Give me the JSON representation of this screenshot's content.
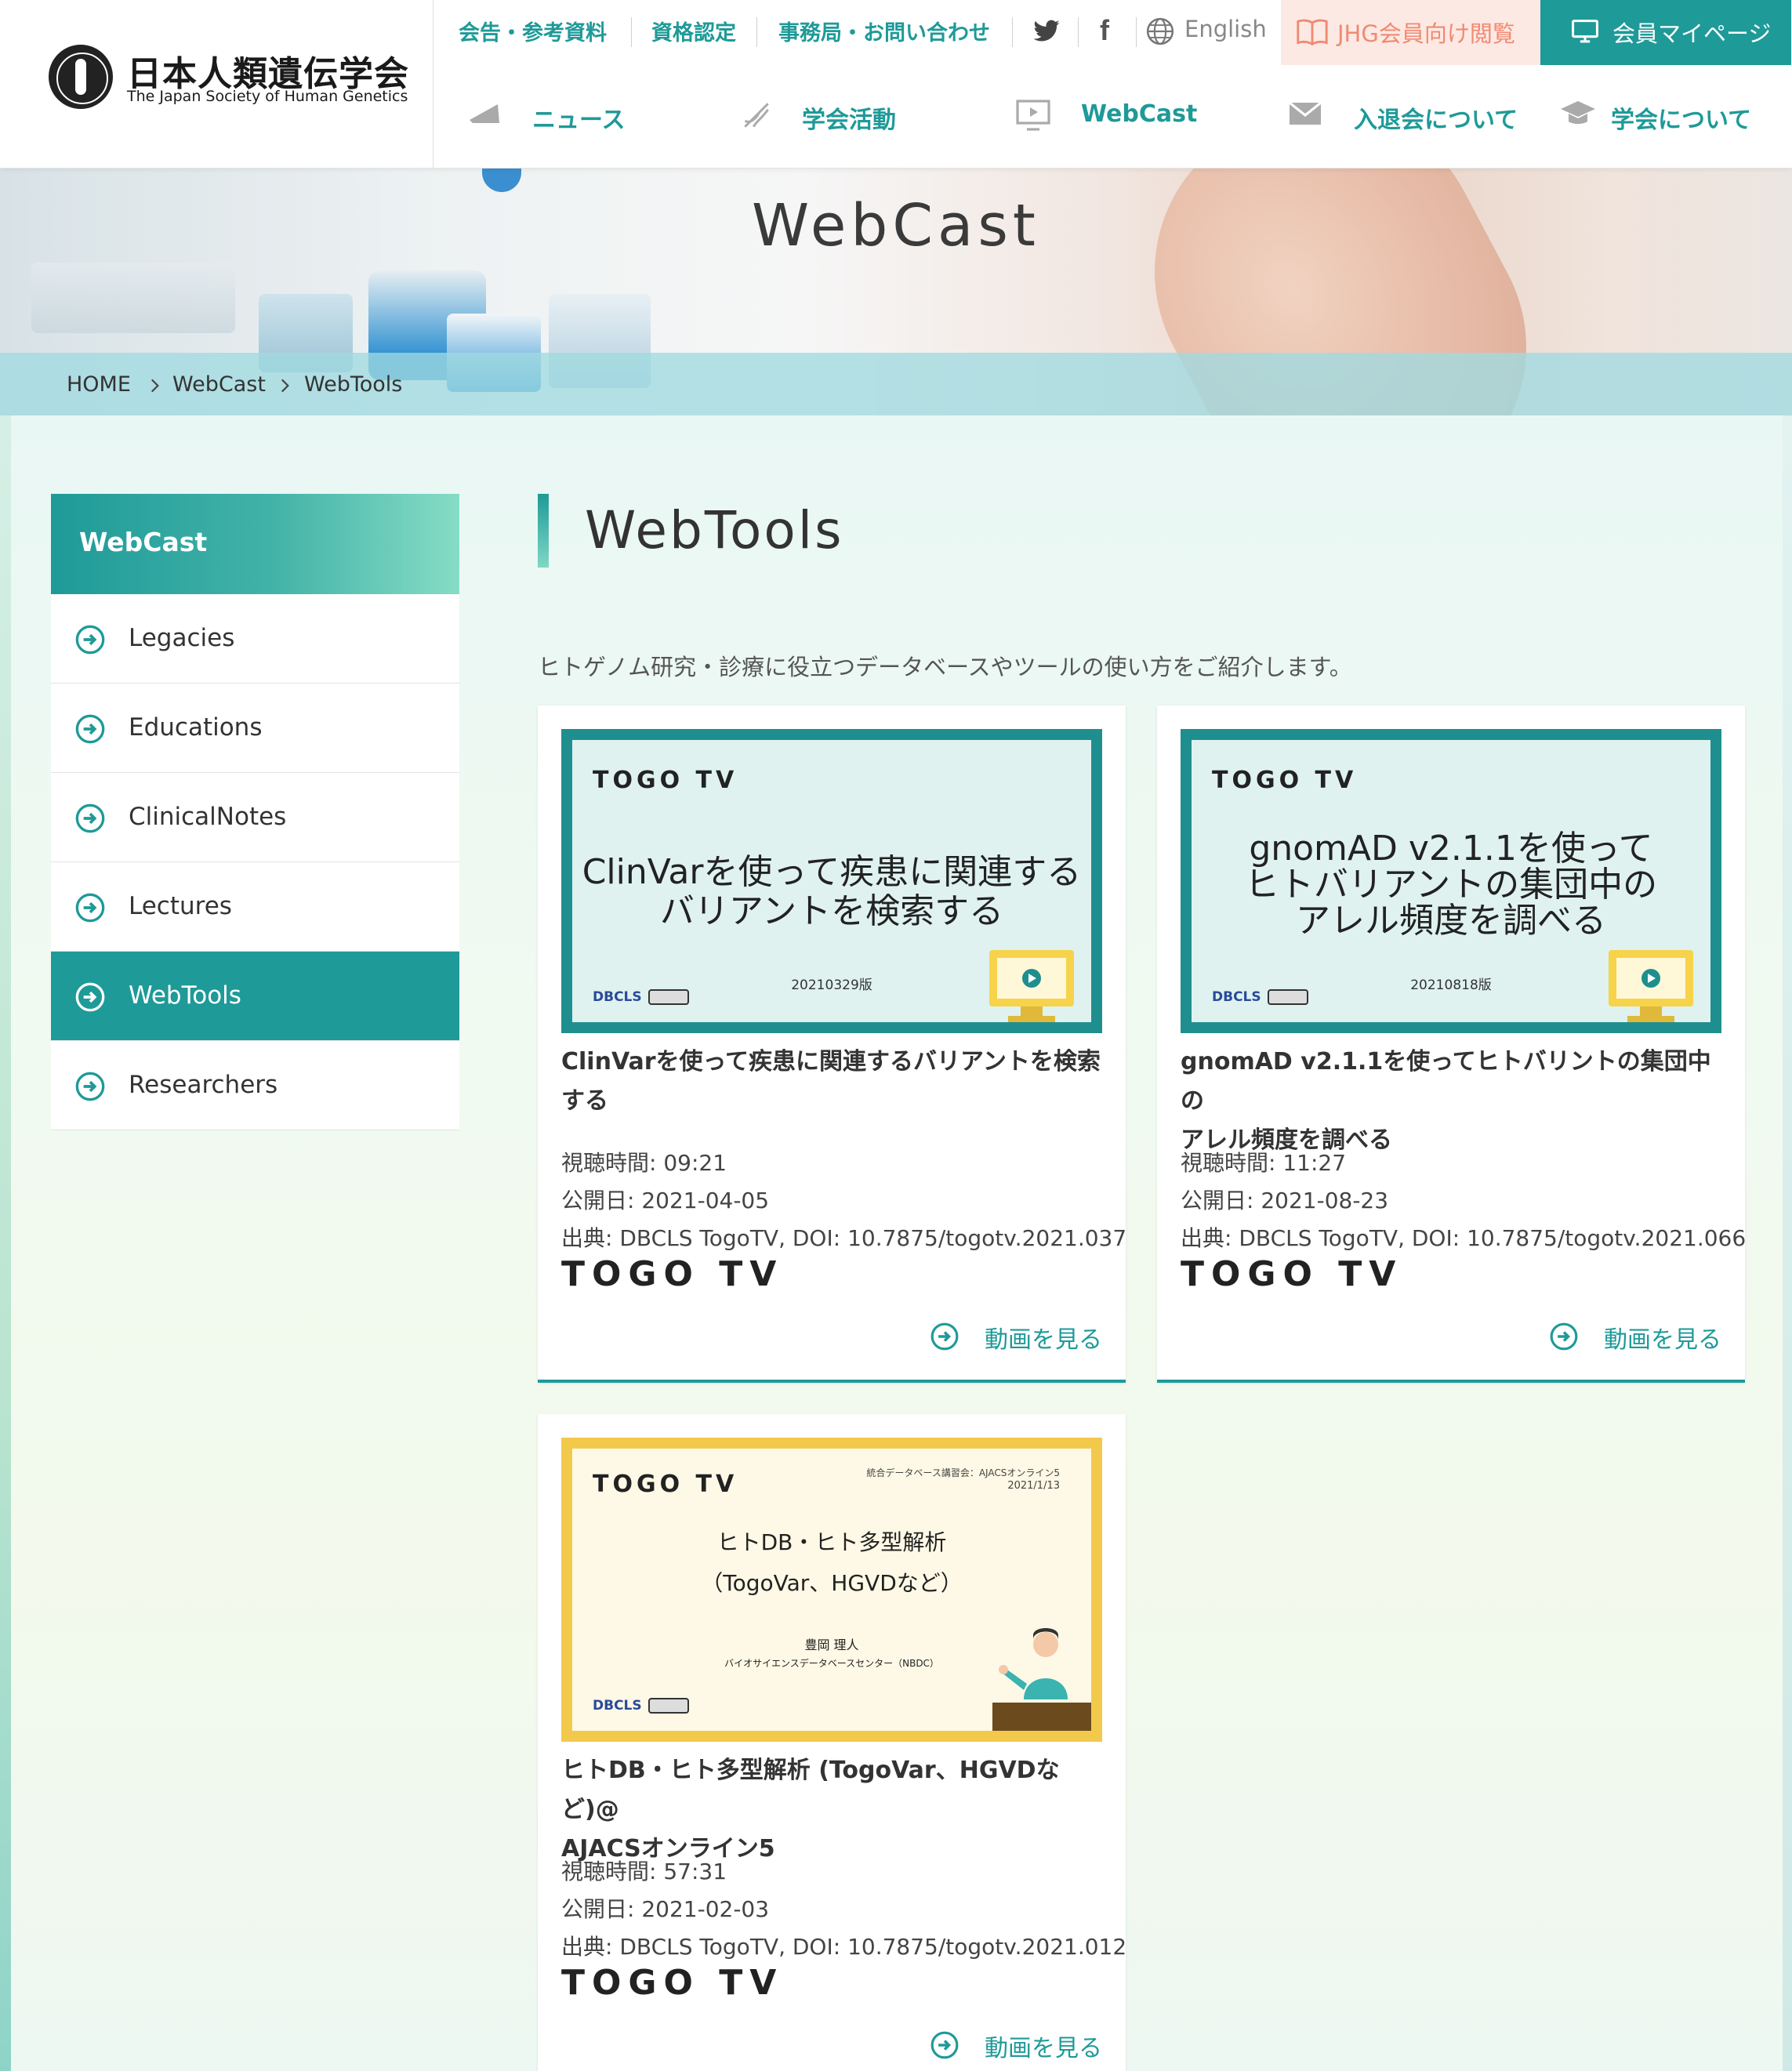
{
  "brand": {
    "name_jp": "日本人類遺伝学会",
    "name_en": "The Japan Society of Human Genetics"
  },
  "top_links": {
    "announcements": "会告・参考資料",
    "certification": "資格認定",
    "contact": "事務局・お問い合わせ",
    "language": "English",
    "jhg_button": "JHG会員向け閲覧",
    "mypage_button": "会員マイページ"
  },
  "main_nav": {
    "news": "ニュース",
    "activities": "学会活動",
    "webcast": "WebCast",
    "membership": "入退会について",
    "about": "学会について"
  },
  "hero": {
    "title": "WebCast"
  },
  "breadcrumb": {
    "home": "HOME",
    "section": "WebCast",
    "current": "WebTools"
  },
  "sidebar": {
    "heading": "WebCast",
    "items": [
      {
        "label": "Legacies"
      },
      {
        "label": "Educations"
      },
      {
        "label": "ClinicalNotes"
      },
      {
        "label": "Lectures"
      },
      {
        "label": "WebTools",
        "active": true
      },
      {
        "label": "Researchers"
      }
    ]
  },
  "page": {
    "title": "WebTools",
    "intro": "ヒトゲノム研究・診療に役立つデータベースやツールの使い方をご紹介します。"
  },
  "cards": [
    {
      "thumb_logo": "TOGO TV",
      "thumb_line1": "ClinVarを使って疾患に関連する",
      "thumb_line2": "バリアントを検索する",
      "thumb_version": "20210329版",
      "thumb_org": "DBCLS",
      "title_line1": "ClinVarを使って疾患に関連するバリアントを検索",
      "title_line2": "する",
      "duration": "視聴時間: 09:21",
      "published": "公開日: 2021-04-05",
      "source": "出典: DBCLS TogoTV, DOI: 10.7875/togotv.2021.037",
      "source_logo": "TOGO TV",
      "watch": "動画を見る"
    },
    {
      "thumb_logo": "TOGO TV",
      "thumb_line1": "gnomAD v2.1.1を使って",
      "thumb_line2": "ヒトバリアントの集団中の",
      "thumb_line3": "アレル頻度を調べる",
      "thumb_version": "20210818版",
      "thumb_org": "DBCLS",
      "title_line1": "gnomAD v2.1.1を使ってヒトバリントの集団中の",
      "title_line2": "アレル頻度を調べる",
      "duration": "視聴時間: 11:27",
      "published": "公開日: 2021-08-23",
      "source": "出典: DBCLS TogoTV, DOI: 10.7875/togotv.2021.066",
      "source_logo": "TOGO TV",
      "watch": "動画を見る"
    },
    {
      "thumb_logo": "TOGO TV",
      "thumb_event": "統合データベース講習会：AJACSオンライン5",
      "thumb_date": "2021/1/13",
      "thumb_line1": "ヒトDB・ヒト多型解析",
      "thumb_line2": "（TogoVar、HGVDなど）",
      "thumb_speaker": "豊岡 理人",
      "thumb_affiliation": "バイオサイエンスデータベースセンター（NBDC）",
      "thumb_org": "DBCLS",
      "title_line1": "ヒトDB・ヒト多型解析 (TogoVar、HGVDなど)@",
      "title_line2": "AJACSオンライン5",
      "duration": "視聴時間: 57:31",
      "published": "公開日: 2021-02-03",
      "source": "出典: DBCLS TogoTV, DOI: 10.7875/togotv.2021.012",
      "source_logo": "TOGO TV",
      "watch": "動画を見る"
    }
  ],
  "colors": {
    "accent": "#1e9a98",
    "jhg_bg": "#fde9e4",
    "jhg_text": "#f08a72",
    "thumb_yellow": "#f3c94c"
  },
  "icons": {
    "twitter": "twitter-icon",
    "facebook": "facebook-icon",
    "globe": "globe-icon",
    "book": "book-icon",
    "monitor": "monitor-icon",
    "arrow_circle": "arrow-circle-icon"
  }
}
